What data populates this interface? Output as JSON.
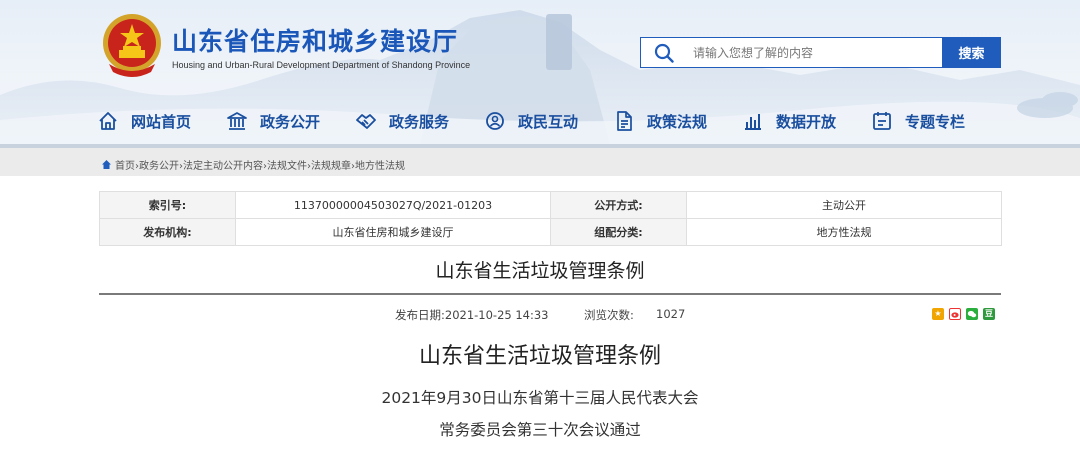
{
  "header": {
    "title": "山东省住房和城乡建设厅",
    "subtitle": "Housing and Urban-Rural Development Department of Shandong Province",
    "brand_color": "#1f5cbc"
  },
  "search": {
    "placeholder": "请输入您想了解的内容",
    "button_label": "搜索"
  },
  "nav": {
    "items": [
      {
        "label": "网站首页",
        "icon": "home-icon"
      },
      {
        "label": "政务公开",
        "icon": "building-icon"
      },
      {
        "label": "政务服务",
        "icon": "handshake-icon"
      },
      {
        "label": "政民互动",
        "icon": "interaction-icon"
      },
      {
        "label": "政策法规",
        "icon": "document-icon"
      },
      {
        "label": "数据开放",
        "icon": "chart-icon"
      },
      {
        "label": "专题专栏",
        "icon": "topic-icon"
      }
    ]
  },
  "breadcrumb": {
    "text": "首页›政务公开›法定主动公开内容›法规文件›法规规章›地方性法规"
  },
  "info": {
    "index_label": "索引号:",
    "index_value": "11370000004503027Q/2021-01203",
    "open_mode_label": "公开方式:",
    "open_mode_value": "主动公开",
    "publisher_label": "发布机构:",
    "publisher_value": "山东省住房和城乡建设厅",
    "category_label": "组配分类:",
    "category_value": "地方性法规"
  },
  "article": {
    "top_title": "山东省生活垃圾管理条例",
    "publish_date": "发布日期:2021-10-25 14:33",
    "views_label": "浏览次数:",
    "views_value": "1027",
    "main_title": "山东省生活垃圾管理条例",
    "line1": "2021年9月30日山东省第十三届人民代表大会",
    "line2": "常务委员会第三十次会议通过"
  },
  "share": {
    "icons": [
      "qzone-icon",
      "weibo-icon",
      "wechat-icon",
      "douban-icon"
    ],
    "douban_glyph": "豆"
  }
}
